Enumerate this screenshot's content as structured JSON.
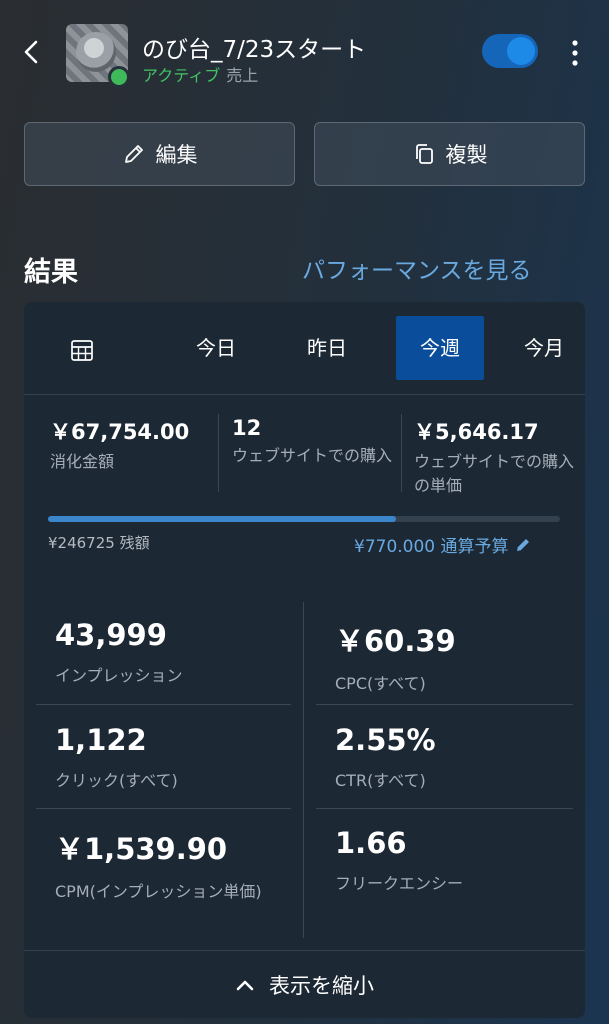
{
  "header": {
    "title": "のび台_7/23スタート",
    "status_active": "アクティブ",
    "status_extra": "売上",
    "toggle_on": true,
    "icons": [
      "back-chevron-icon",
      "more-vertical-icon"
    ]
  },
  "actions": {
    "edit_label": "編集",
    "copy_label": "複製"
  },
  "results": {
    "title": "結果",
    "performance_link": "パフォーマンスを見る"
  },
  "tabs": [
    {
      "label": "今日"
    },
    {
      "label": "昨日"
    },
    {
      "label": "今週",
      "selected": true
    },
    {
      "label": "今月"
    }
  ],
  "stats": [
    {
      "value": "￥67,754.00",
      "label": "消化金額"
    },
    {
      "value": "12",
      "label": "ウェブサイトでの購入"
    },
    {
      "value": "￥5,646.17",
      "label": "ウェブサイトでの購入の単価"
    }
  ],
  "budget": {
    "remaining": "¥246725 残額",
    "total": "¥770.000 通算予算",
    "spent_fraction": 0.68
  },
  "metrics": [
    {
      "value": "43,999",
      "label": "インプレッション"
    },
    {
      "value": "￥60.39",
      "label": "CPC(すべて)"
    },
    {
      "value": "1,122",
      "label": "クリック(すべて)"
    },
    {
      "value": "2.55%",
      "label": "CTR(すべて)"
    },
    {
      "value": "￥1,539.90",
      "label": "CPM(インプレッション単価)"
    },
    {
      "value": "1.66",
      "label": "フリークエンシー"
    }
  ],
  "collapse_label": "表示を縮小",
  "colors": {
    "accent": "#69a9e0",
    "active_green": "#42c464",
    "selected_tab": "#0a4d9a",
    "toggle": "#1d8ae8"
  }
}
